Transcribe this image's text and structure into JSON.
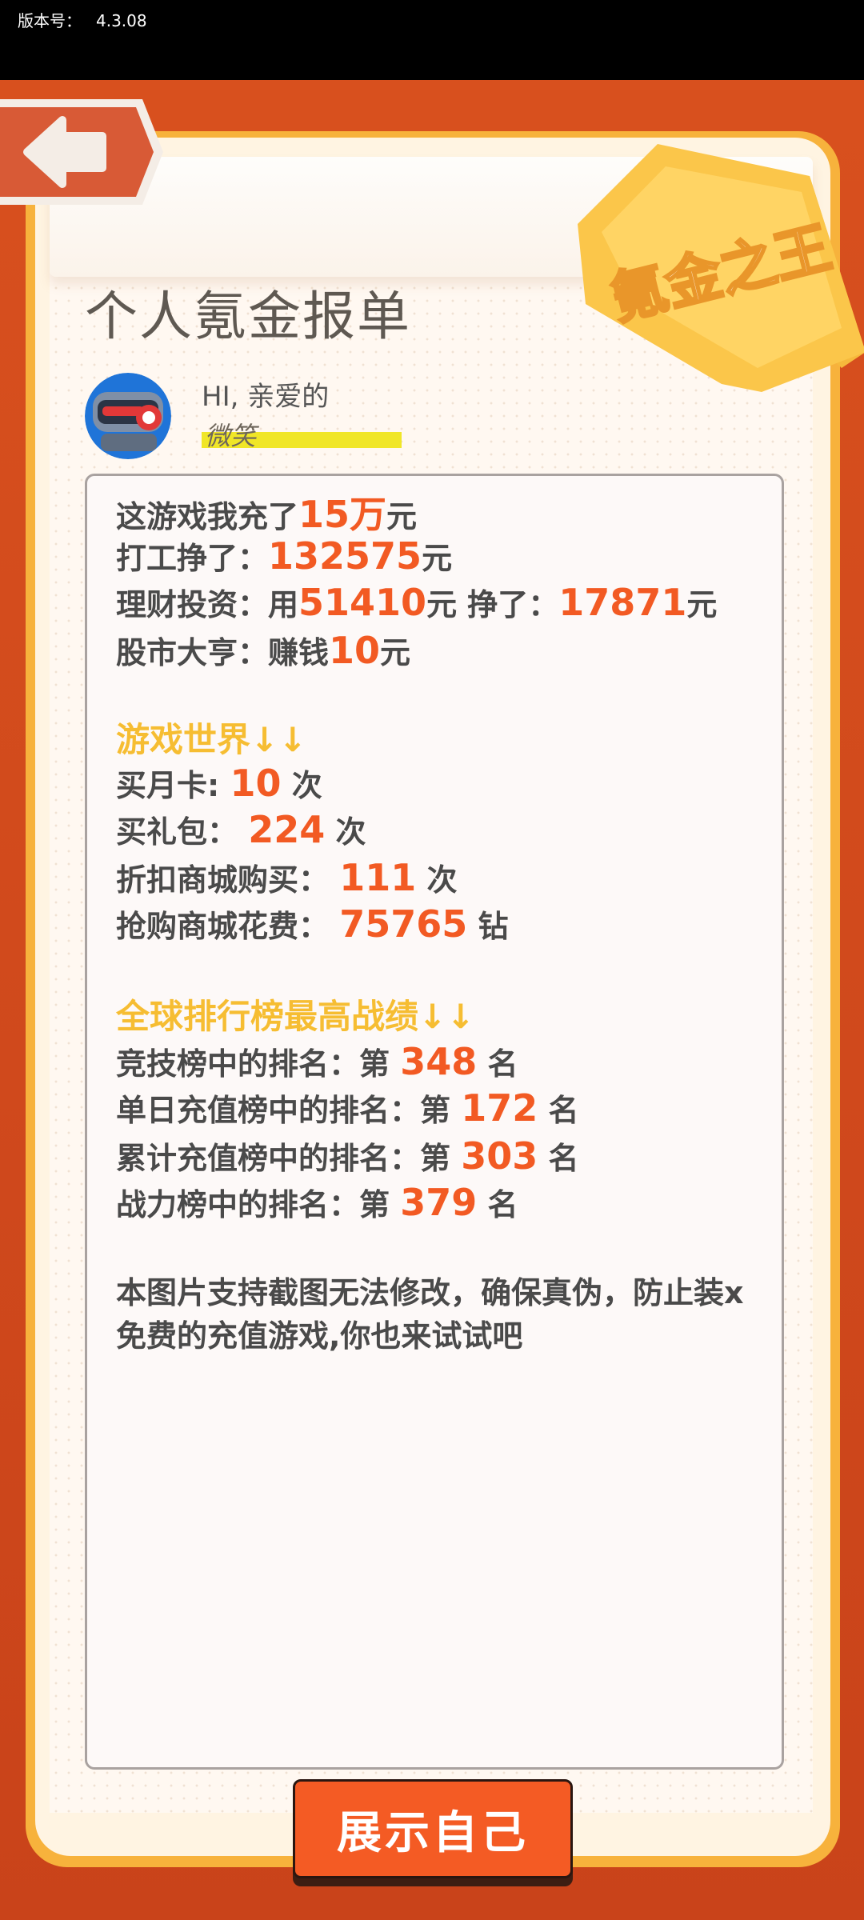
{
  "status": {
    "version_label": "版本号：",
    "version_value": "4.3.08"
  },
  "header": {
    "ribbon_text": "氪金之王",
    "title": "个人氪金报单"
  },
  "profile": {
    "greeting": "HI, 亲爱的",
    "nickname": "微笑"
  },
  "report": {
    "l1": {
      "pre": "这游戏我充了",
      "num": "15万",
      "post": "元"
    },
    "l2": {
      "pre": "打工挣了：",
      "num": "132575",
      "post": "元"
    },
    "l3": {
      "pre": "理财投资：用",
      "num1": "51410",
      "mid": "元 挣了：",
      "num2": "17871",
      "post": "元"
    },
    "l4": {
      "pre": "股市大亨：赚钱",
      "num": "10",
      "post": "元"
    },
    "section_game": "游戏世界↓↓",
    "l5": {
      "pre": "买月卡:",
      "num": "10",
      "post": "次"
    },
    "l6": {
      "pre": "买礼包：",
      "num": "224",
      "post": "次"
    },
    "l7": {
      "pre": "折扣商城购买：",
      "num": "111",
      "post": "次"
    },
    "l8": {
      "pre": "抢购商城花费：",
      "num": "75765",
      "post": "钻"
    },
    "section_rank": "全球排行榜最高战绩↓↓",
    "r1": {
      "pre": "竞技榜中的排名：第",
      "num": "348",
      "post": "名"
    },
    "r2": {
      "pre": "单日充值榜中的排名：第",
      "num": "172",
      "post": "名"
    },
    "r3": {
      "pre": "累计充值榜中的排名：第",
      "num": "303",
      "post": "名"
    },
    "r4": {
      "pre": "战力榜中的排名：第",
      "num": "379",
      "post": "名"
    },
    "note_line1": "本图片支持截图无法修改，确保真伪，防止装x",
    "note_line2": "免费的充值游戏,你也来试试吧"
  },
  "actions": {
    "show_button": "展示自己"
  },
  "colors": {
    "accent": "#f25a23",
    "section": "#f6bd32",
    "frame": "#d8501e",
    "frame_gold": "#f7b23c"
  }
}
